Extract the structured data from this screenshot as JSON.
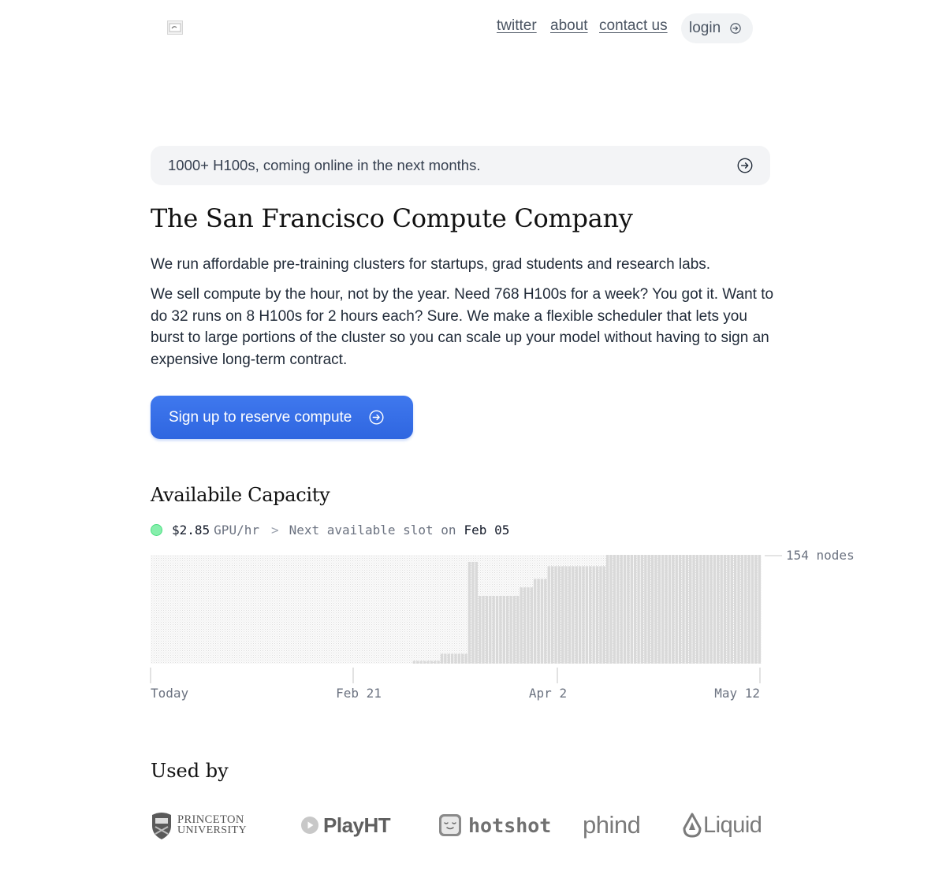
{
  "nav": {
    "logo_icon": "site-logo-image",
    "links": [
      "twitter",
      "about",
      "contact us"
    ],
    "login_label": "login",
    "login_icon": "arrow-right-circle-icon"
  },
  "banner": {
    "text": "1000+ H100s, coming online in the next months.",
    "icon": "arrow-right-circle-icon"
  },
  "hero": {
    "title": "The San Francisco Compute Company",
    "paragraph_1": "We run affordable pre-training clusters for startups, grad students and research labs.",
    "paragraph_2": "We sell compute by the hour, not by the year. Need 768 H100s for a week? You got it. Want to do 32 runs on 8 H100s for 2 hours each? Sure. We make a flexible scheduler that lets you burst to large portions of the cluster so you can scale up your model without having to sign an expensive long-term contract.",
    "cta_label": "Sign up to reserve compute",
    "cta_icon": "arrow-right-circle-icon",
    "cta_color": "#3a72eb"
  },
  "capacity": {
    "title": "Availabile Capacity",
    "status_color": "#86efac",
    "price": "$2.85",
    "price_unit": "GPU/hr",
    "separator": ">",
    "next_slot_label": "Next available slot on",
    "next_slot_date": "Feb 05"
  },
  "chart_data": {
    "type": "bar",
    "title": "",
    "xlabel": "",
    "ylabel": "",
    "max_label": "154 nodes",
    "ylim": [
      0,
      154
    ],
    "x_ticks": [
      "Today",
      "Feb 21",
      "Apr 2",
      "May 12"
    ],
    "bar_color": "#d9d9d9",
    "background_pattern": "dotted",
    "values": [
      0,
      0,
      0,
      0,
      0,
      0,
      0,
      0,
      0,
      0,
      0,
      0,
      0,
      0,
      0,
      0,
      0,
      0,
      0,
      0,
      0,
      0,
      0,
      0,
      0,
      0,
      0,
      0,
      0,
      0,
      0,
      0,
      0,
      0,
      0,
      0,
      0,
      0,
      0,
      0,
      0,
      0,
      0,
      0,
      0,
      0,
      0,
      0,
      0,
      0,
      0,
      0,
      0,
      0,
      0,
      0,
      0,
      0,
      0,
      0,
      0,
      0,
      0,
      0,
      0,
      0,
      0,
      0,
      0,
      0,
      0,
      0,
      0,
      0,
      0,
      0,
      4,
      4,
      4,
      4,
      4,
      4,
      4,
      4,
      14,
      14,
      14,
      14,
      14,
      14,
      14,
      14,
      144,
      144,
      144,
      96,
      96,
      96,
      96,
      96,
      96,
      96,
      96,
      96,
      96,
      96,
      96,
      108,
      108,
      108,
      108,
      120,
      120,
      120,
      120,
      138,
      138,
      138,
      138,
      138,
      138,
      138,
      138,
      138,
      138,
      138,
      138,
      138,
      138,
      138,
      138,
      138,
      154,
      154,
      154,
      154,
      154,
      154,
      154,
      154,
      154,
      154,
      154,
      154,
      154,
      154,
      154,
      154,
      154,
      154,
      154,
      154,
      154,
      154,
      154,
      154,
      154,
      154,
      154,
      154,
      154,
      154,
      154,
      154,
      154,
      154,
      154,
      154,
      154,
      154,
      154,
      154,
      154,
      154,
      154,
      154,
      154
    ]
  },
  "used_by": {
    "title": "Used by",
    "logos": [
      {
        "name": "princeton-logo",
        "line1": "PRINCETON",
        "line2": "UNIVERSITY"
      },
      {
        "name": "playht-logo",
        "text": "PlayHT"
      },
      {
        "name": "hotshot-logo",
        "text": "hotshot"
      },
      {
        "name": "phind-logo",
        "text": "phind"
      },
      {
        "name": "liquid-logo",
        "text": "Liquid"
      }
    ]
  }
}
